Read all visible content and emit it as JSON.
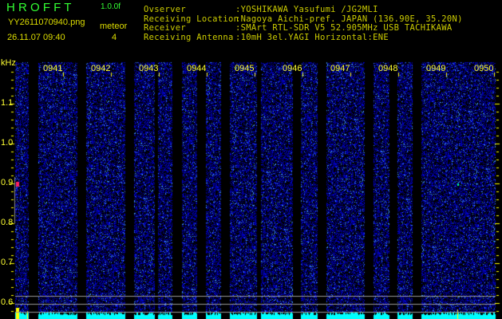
{
  "header": {
    "app_title": "H R O F F T",
    "version": "1.0.0f",
    "filename": "YY2611070940.png",
    "datetime": "26.11.07 09:40",
    "meteor_label": "meteor",
    "meteor_count": "4"
  },
  "info": [
    {
      "label": "Ovserver",
      "value": ":YOSHIKAWA Yasufumi /JG2MLI"
    },
    {
      "label": "Receiving Location",
      "value": ":Nagoya Aichi-pref. JAPAN (136.90E, 35.20N)"
    },
    {
      "label": "Receiver",
      "value": ":SMArt RTL-SDR V5 52.905MHz USB TACHIKAWA"
    },
    {
      "label": "Receiving Antenna",
      "value": ":10mH 3el.YAGI Horizontal:ENE"
    }
  ],
  "axis": {
    "unit": "kHz",
    "ticks": [
      "1.1",
      "1.0",
      "0.9",
      "0.8",
      "0.7",
      "0.6"
    ]
  },
  "time_labels": [
    "0941",
    "0942",
    "0943",
    "0944",
    "0945",
    "0946",
    "0947",
    "0948",
    "0949",
    "0950"
  ],
  "colors": {
    "text_yellow": "#cccc00",
    "title_green": "#33ff33",
    "noise": "#1a1aff",
    "level": "#00ffff"
  }
}
